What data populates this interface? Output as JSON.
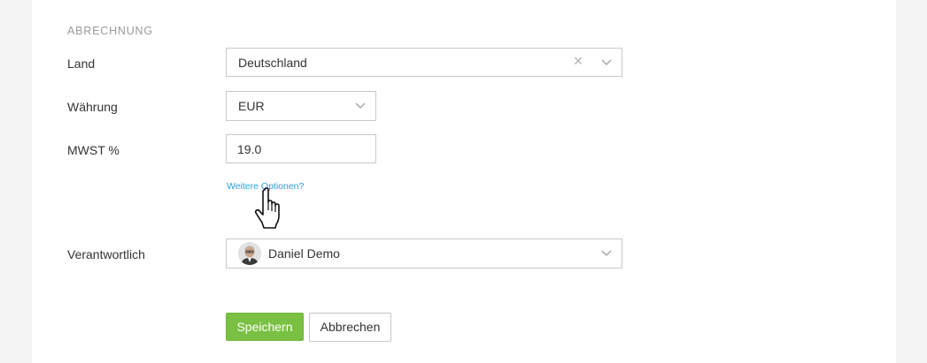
{
  "section": {
    "title": "ABRECHNUNG"
  },
  "fields": {
    "land": {
      "label": "Land",
      "value": "Deutschland"
    },
    "waehrung": {
      "label": "Währung",
      "value": "EUR"
    },
    "mwst": {
      "label": "MWST %",
      "value": "19.0"
    },
    "verantwortlich": {
      "label": "Verantwortlich",
      "value": "Daniel Demo"
    }
  },
  "links": {
    "more_options": "Weitere Optionen?"
  },
  "buttons": {
    "save": "Speichern",
    "cancel": "Abbrechen"
  },
  "icons": {
    "clear": "close-icon",
    "dropdown": "chevron-down-icon",
    "cursor": "hand-pointer-icon",
    "avatar": "user-avatar"
  },
  "colors": {
    "accent": "#7ac143",
    "link": "#2a9fd6",
    "section_title": "#9a9a9a"
  }
}
